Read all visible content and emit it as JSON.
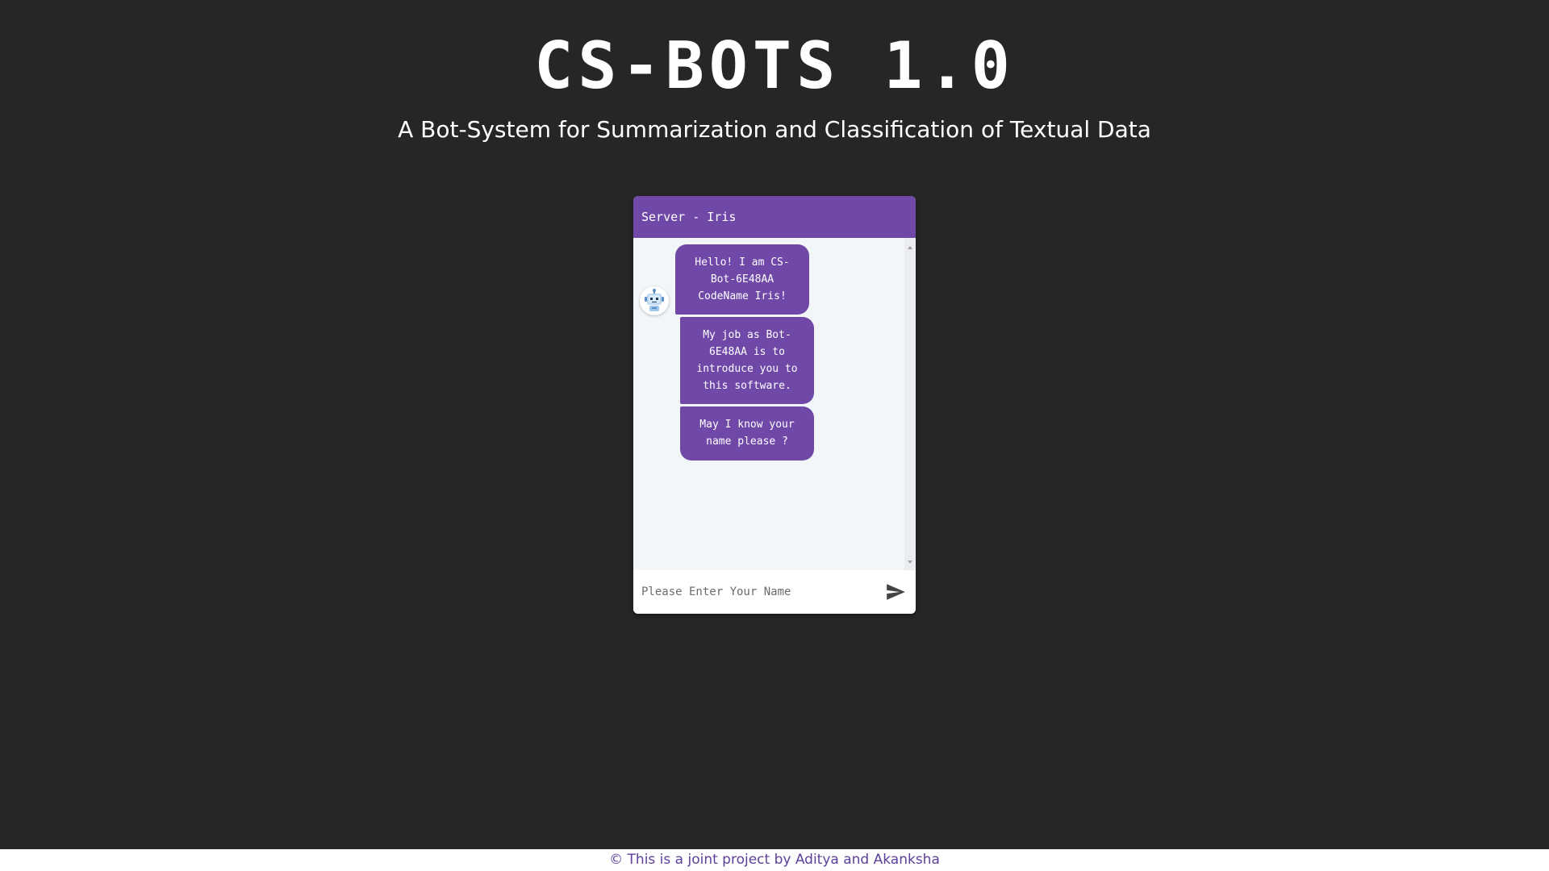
{
  "header": {
    "title": "CS-BOTS 1.0",
    "subtitle": "A Bot-System for Summarization and Classification of Textual Data"
  },
  "chat": {
    "header_title": "Server - Iris",
    "avatar_icon": "robot-icon",
    "messages": [
      {
        "sender": "bot",
        "text": "Hello! I am CS-Bot-6E48AA CodeName Iris!"
      },
      {
        "sender": "bot",
        "text": "My job as Bot-6E48AA is to introduce you to this software."
      },
      {
        "sender": "bot",
        "text": "May I know your name please ?"
      }
    ],
    "input_placeholder": "Please Enter Your Name",
    "input_value": "",
    "send_icon": "send-icon"
  },
  "footer": {
    "text": "© This is a joint project by Aditya and Akanksha"
  },
  "colors": {
    "background": "#262626",
    "accent": "#6f48a8",
    "chat_body": "#f3f6f9",
    "footer_text": "#5d3f9a"
  }
}
